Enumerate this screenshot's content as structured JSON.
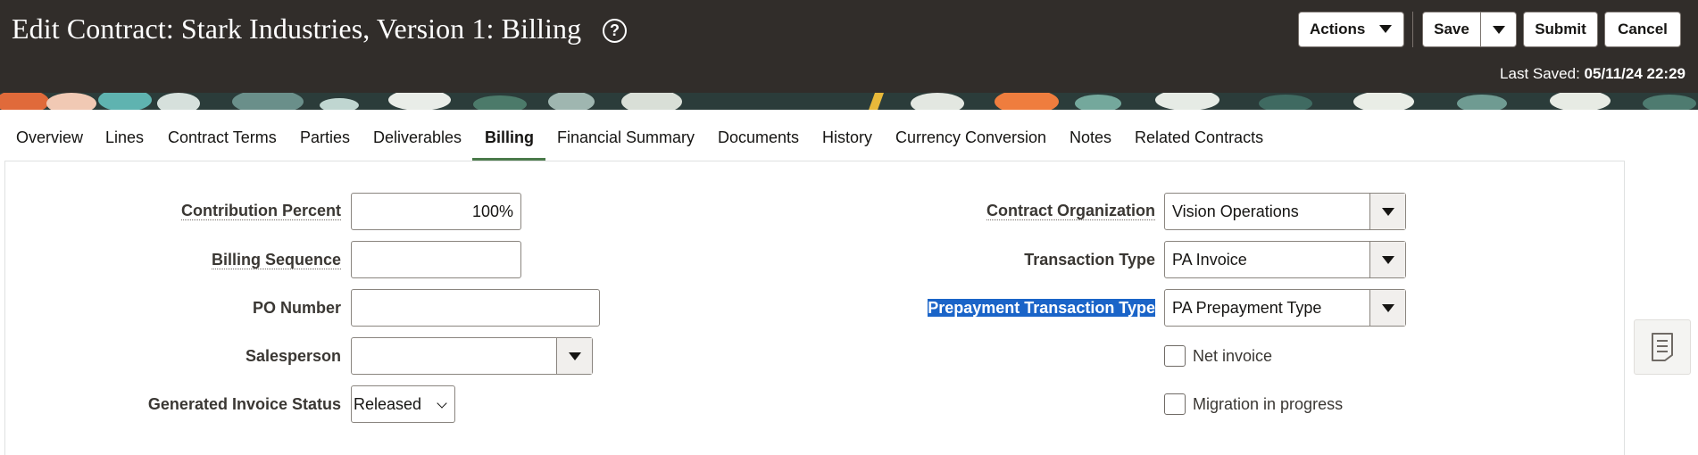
{
  "header": {
    "title": "Edit Contract: Stark Industries, Version 1: Billing",
    "help_icon": "question-circle-icon",
    "actions_label": "Actions",
    "save_label": "Save",
    "submit_label": "Submit",
    "cancel_label": "Cancel",
    "last_saved_label": "Last Saved:",
    "last_saved_value": "05/11/24 22:29"
  },
  "tabs": [
    {
      "label": "Overview"
    },
    {
      "label": "Lines"
    },
    {
      "label": "Contract Terms"
    },
    {
      "label": "Parties"
    },
    {
      "label": "Deliverables"
    },
    {
      "label": "Billing",
      "active": true
    },
    {
      "label": "Financial Summary"
    },
    {
      "label": "Documents"
    },
    {
      "label": "History"
    },
    {
      "label": "Currency Conversion"
    },
    {
      "label": "Notes"
    },
    {
      "label": "Related Contracts"
    }
  ],
  "form_left": {
    "contribution_percent": {
      "label": "Contribution Percent",
      "value": "100%"
    },
    "billing_sequence": {
      "label": "Billing Sequence",
      "value": ""
    },
    "po_number": {
      "label": "PO Number",
      "value": ""
    },
    "salesperson": {
      "label": "Salesperson",
      "value": ""
    },
    "generated_invoice_status": {
      "label": "Generated Invoice Status",
      "value": "Released"
    }
  },
  "form_right": {
    "contract_organization": {
      "label": "Contract Organization",
      "value": "Vision Operations"
    },
    "transaction_type": {
      "label": "Transaction Type",
      "value": "PA Invoice"
    },
    "prepayment_transaction_type": {
      "label": "Prepayment Transaction Type",
      "value": "PA Prepayment Type"
    },
    "net_invoice": {
      "label": "Net invoice",
      "checked": false
    },
    "migration_in_progress": {
      "label": "Migration in progress",
      "checked": false
    }
  },
  "colors": {
    "header_bg": "#312d2a",
    "active_tab_underline": "#4a7a4a",
    "selection_highlight": "#1a64c8"
  },
  "side_panel_icon": "document-icon"
}
